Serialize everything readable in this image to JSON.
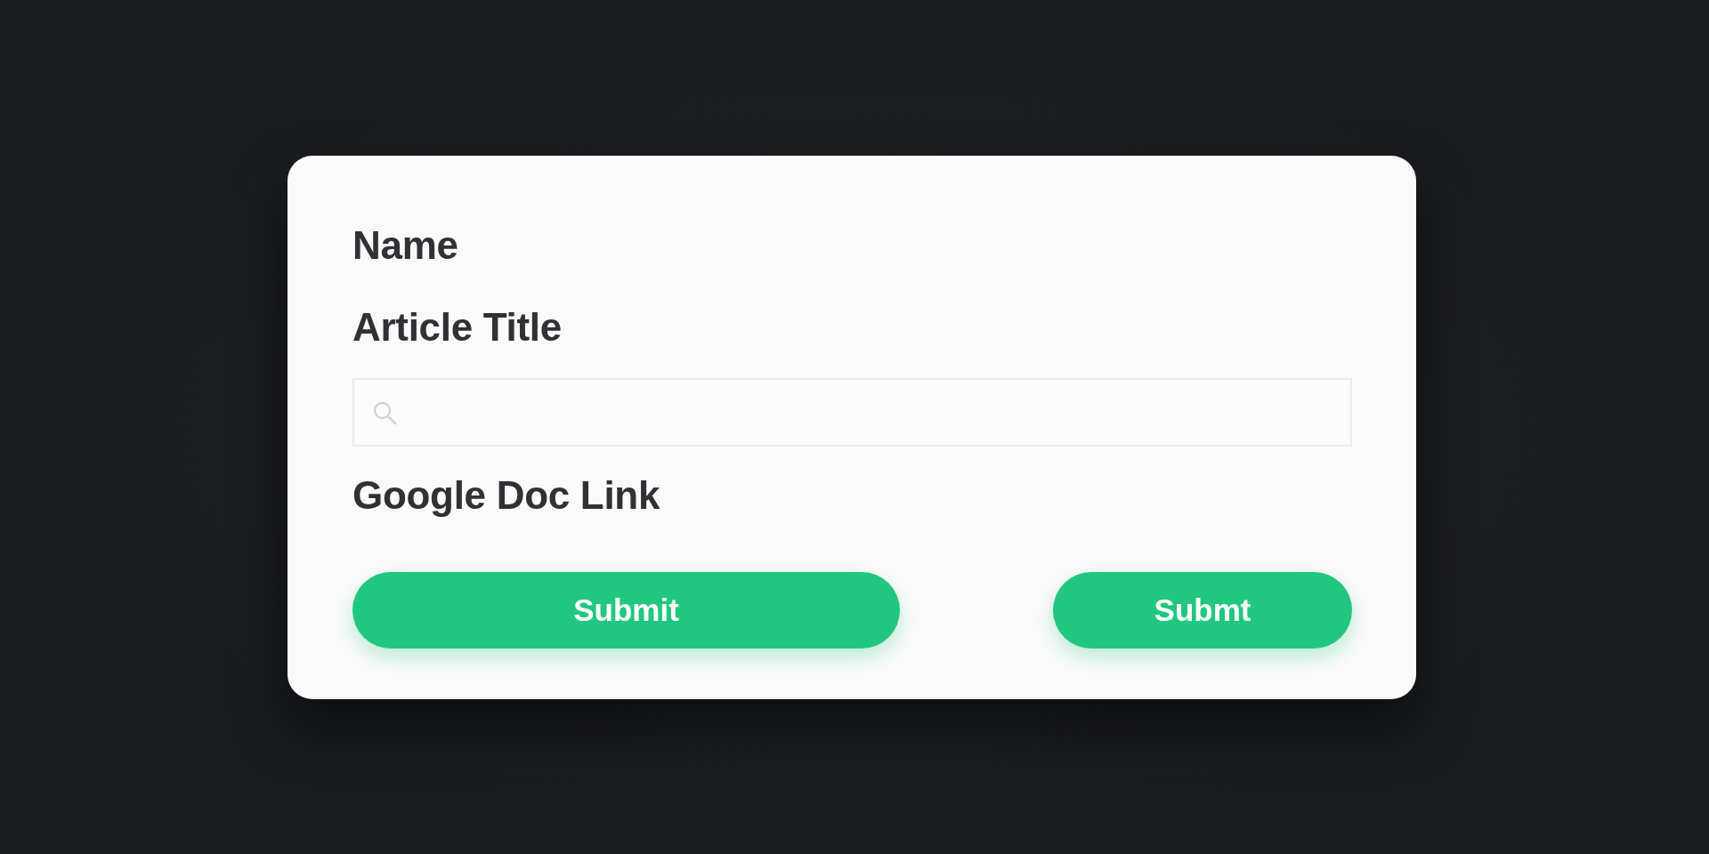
{
  "form": {
    "items": [
      {
        "kind": "label",
        "text": "Name"
      },
      {
        "kind": "label",
        "text": "Article Title"
      },
      {
        "kind": "search_field"
      },
      {
        "kind": "label",
        "text": "Google Doc Link"
      }
    ],
    "buttons": [
      {
        "label": "Submit",
        "kind": "wide"
      },
      {
        "label": "Submt",
        "kind": "narrow"
      }
    ]
  }
}
